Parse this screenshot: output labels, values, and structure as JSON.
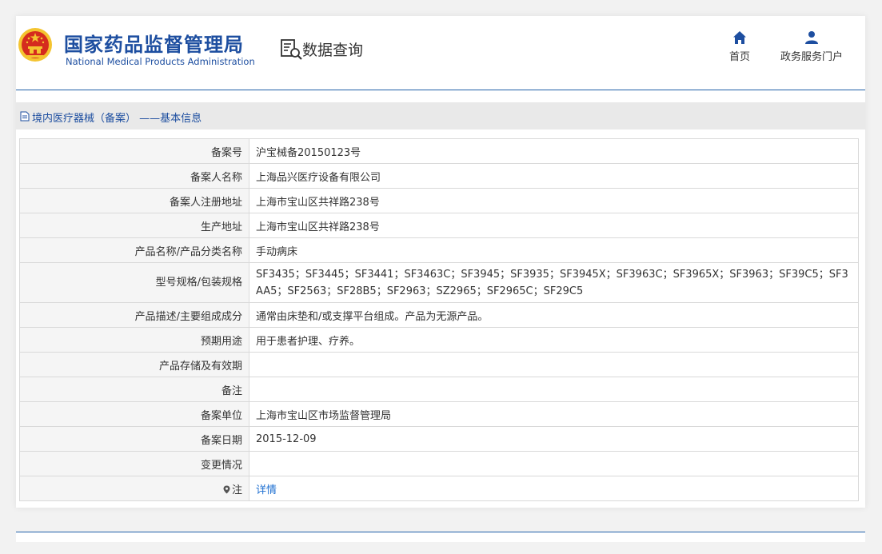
{
  "header": {
    "brand_cn": "国家药品监督管理局",
    "brand_en": "National Medical Products Administration",
    "query_label": "数据查询",
    "nav": {
      "home_label": "首页",
      "portal_label": "政务服务门户"
    }
  },
  "section": {
    "title": "境内医疗器械（备案） ——基本信息"
  },
  "record": {
    "rows": [
      {
        "label": "备案号",
        "value": "沪宝械备20150123号"
      },
      {
        "label": "备案人名称",
        "value": "上海品兴医疗设备有限公司"
      },
      {
        "label": "备案人注册地址",
        "value": "上海市宝山区共祥路238号"
      },
      {
        "label": "生产地址",
        "value": "上海市宝山区共祥路238号"
      },
      {
        "label": "产品名称/产品分类名称",
        "value": "手动病床"
      },
      {
        "label": "型号规格/包装规格",
        "value": "SF3435；SF3445；SF3441；SF3463C；SF3945；SF3935；SF3945X；SF3963C；SF3965X；SF3963；SF39C5；SF3AA5；SF2563；SF28B5；SF2963；SZ2965；SF2965C；SF29C5"
      },
      {
        "label": "产品描述/主要组成成分",
        "value": "通常由床垫和/或支撑平台组成。产品为无源产品。"
      },
      {
        "label": "预期用途",
        "value": "用于患者护理、疗养。"
      },
      {
        "label": "产品存储及有效期",
        "value": ""
      },
      {
        "label": "备注",
        "value": ""
      },
      {
        "label": "备案单位",
        "value": "上海市宝山区市场监督管理局"
      },
      {
        "label": "备案日期",
        "value": "2015-12-09"
      },
      {
        "label": "变更情况",
        "value": ""
      },
      {
        "label": "注",
        "value": "详情"
      }
    ]
  },
  "colors": {
    "brand_blue": "#1d4ea0",
    "link_blue": "#1d6fd1",
    "emblem_red": "#d52b1e",
    "emblem_gold": "#f4c430"
  },
  "icons": {
    "emblem": "national-emblem-icon",
    "query": "search-document-icon",
    "home": "home-icon",
    "portal": "user-icon",
    "section": "document-icon",
    "note": "pin-icon"
  }
}
